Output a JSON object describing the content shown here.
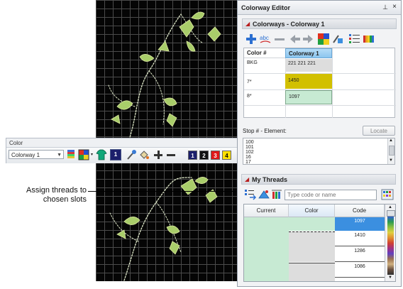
{
  "colors": {
    "canvas_bg": "#050505",
    "grid": "#4b4b4b",
    "embroidery_light": "#dbe7a0",
    "embroidery_dark": "#9bc05a",
    "accent_blue": "#3b8fe0",
    "slot_yellow": "#d2c000",
    "slot_mint": "#c7ead3"
  },
  "toolbar": {
    "title": "Color",
    "colorway_select": "Colorway 1",
    "slots": [
      {
        "label": "1",
        "color": "#1c1f6b",
        "text_color": "#ffffff"
      },
      {
        "label": "2",
        "color": "#111111",
        "text_color": "#ffffff"
      },
      {
        "label": "3",
        "color": "#e01919",
        "text_color": "#ffffff"
      },
      {
        "label": "4",
        "color": "#ffe000",
        "text_color": "#000000"
      }
    ]
  },
  "callout": {
    "text_line1": "Assign threads to",
    "text_line2": "chosen slots"
  },
  "panel": {
    "title": "Colorway Editor",
    "pin_glyph": "⊥",
    "close_glyph": "×",
    "colorways_section": "Colorways - Colorway 1",
    "table": {
      "col_color_num": "Color #",
      "col_colorway": "Colorway 1",
      "rows": [
        {
          "num": "BKG",
          "value": "221 221 221"
        },
        {
          "num": "7*",
          "value": "1450"
        },
        {
          "num": "8*",
          "value": "1097"
        }
      ]
    },
    "stop_label": "Stop # - Element:",
    "locate_button": "Locate",
    "stop_items": [
      "100",
      "101",
      "102",
      "16",
      "17"
    ],
    "my_threads_section": "My Threads",
    "search_placeholder": "Type code or name",
    "grid": {
      "col_current": "Current",
      "col_color": "Color",
      "col_code": "Code",
      "codes": [
        "1097",
        "1410",
        "1286",
        "1086"
      ]
    }
  }
}
